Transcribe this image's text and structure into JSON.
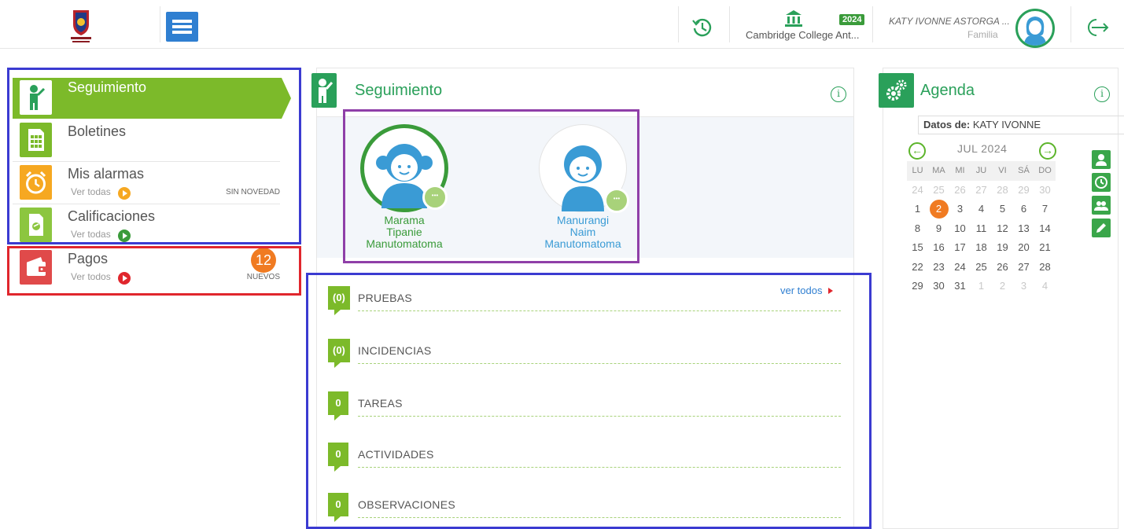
{
  "header": {
    "school_name": "Cambridge College Ant...",
    "year": "2024",
    "user_name": "KATY IVONNE ASTORGA ...",
    "user_role": "Familia"
  },
  "sidebar": {
    "items": [
      {
        "title": "Seguimiento",
        "sub": "",
        "note": ""
      },
      {
        "title": "Boletines",
        "sub": "",
        "note": ""
      },
      {
        "title": "Mis alarmas",
        "sub": "Ver todas",
        "note": "SIN NOVEDAD"
      },
      {
        "title": "Calificaciones",
        "sub": "Ver todas",
        "note": ""
      },
      {
        "title": "Pagos",
        "sub": "Ver todos",
        "note": "NUEVOS",
        "badge": "12"
      }
    ]
  },
  "seguimiento": {
    "title": "Seguimiento",
    "students": [
      {
        "name": "Marama\nTipanie\nManutomatoma",
        "color": "#3a9b3a"
      },
      {
        "name": "Manurangi\nNaim\nManutomatoma",
        "color": "#3a9bd5"
      }
    ],
    "ver_todos": "ver todos",
    "rows": [
      {
        "count": "(0)",
        "label": "PRUEBAS"
      },
      {
        "count": "(0)",
        "label": "INCIDENCIAS"
      },
      {
        "count": "0",
        "label": "TAREAS"
      },
      {
        "count": "0",
        "label": "ACTIVIDADES"
      },
      {
        "count": "0",
        "label": "OBSERVACIONES"
      }
    ]
  },
  "agenda": {
    "title": "Agenda",
    "datos_label": "Datos de:",
    "datos_value": "KATY IVONNE",
    "month": "JUL 2024",
    "weekdays": [
      "LU",
      "MA",
      "MI",
      "JU",
      "VI",
      "SÁ",
      "DO"
    ],
    "weeks": [
      [
        "24",
        "25",
        "26",
        "27",
        "28",
        "29",
        "30"
      ],
      [
        "1",
        "2",
        "3",
        "4",
        "5",
        "6",
        "7"
      ],
      [
        "8",
        "9",
        "10",
        "11",
        "12",
        "13",
        "14"
      ],
      [
        "15",
        "16",
        "17",
        "18",
        "19",
        "20",
        "21"
      ],
      [
        "22",
        "23",
        "24",
        "25",
        "26",
        "27",
        "28"
      ],
      [
        "29",
        "30",
        "31",
        "1",
        "2",
        "3",
        "4"
      ]
    ],
    "today": "2"
  },
  "colors": {
    "green": "#7cba2a",
    "dark_green": "#2aa05a",
    "blue": "#2f7fd1",
    "orange": "#f07b22",
    "red": "#e0262d"
  }
}
